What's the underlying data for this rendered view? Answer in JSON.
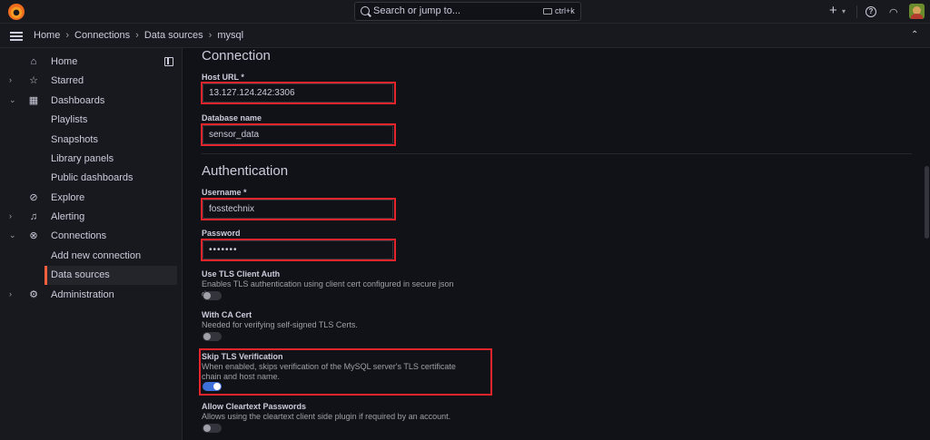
{
  "topbar": {
    "search_placeholder": "Search or jump to...",
    "shortcut": "ctrl+k",
    "plus": "+",
    "help": "?"
  },
  "breadcrumb": [
    "Home",
    "Connections",
    "Data sources",
    "mysql"
  ],
  "sidebar": {
    "items": [
      {
        "label": "Home",
        "icon": "home-icon"
      },
      {
        "label": "Starred",
        "icon": "star-icon"
      },
      {
        "label": "Dashboards",
        "icon": "grid-icon"
      },
      {
        "label": "Playlists"
      },
      {
        "label": "Snapshots"
      },
      {
        "label": "Library panels"
      },
      {
        "label": "Public dashboards"
      },
      {
        "label": "Explore",
        "icon": "compass-icon"
      },
      {
        "label": "Alerting",
        "icon": "bell-icon"
      },
      {
        "label": "Connections",
        "icon": "plug-icon"
      },
      {
        "label": "Add new connection"
      },
      {
        "label": "Data sources"
      },
      {
        "label": "Administration",
        "icon": "gear-icon"
      }
    ]
  },
  "connection": {
    "title": "Connection",
    "host_label": "Host URL *",
    "host_value": "13.127.124.242:3306",
    "db_label": "Database name",
    "db_value": "sensor_data"
  },
  "auth": {
    "title": "Authentication",
    "username_label": "Username *",
    "username_value": "fosstechnix",
    "password_label": "Password",
    "password_value": "•••••••",
    "tls_auth_label": "Use TLS Client Auth",
    "tls_auth_desc": "Enables TLS authentication using client cert configured in secure json data.",
    "ca_label": "With CA Cert",
    "ca_desc": "Needed for verifying self-signed TLS Certs.",
    "skip_label": "Skip TLS Verification",
    "skip_desc": "When enabled, skips verification of the MySQL server's TLS certificate chain and host name.",
    "cleartext_label": "Allow Cleartext Passwords",
    "cleartext_desc": "Allows using the cleartext client side plugin if required by an account."
  },
  "toggles": {
    "tls_auth": false,
    "ca_cert": false,
    "skip_tls": true,
    "cleartext": false
  },
  "colors": {
    "highlight": "#e5242b",
    "accent": "#3d71d9",
    "active": "#f55f3e"
  }
}
